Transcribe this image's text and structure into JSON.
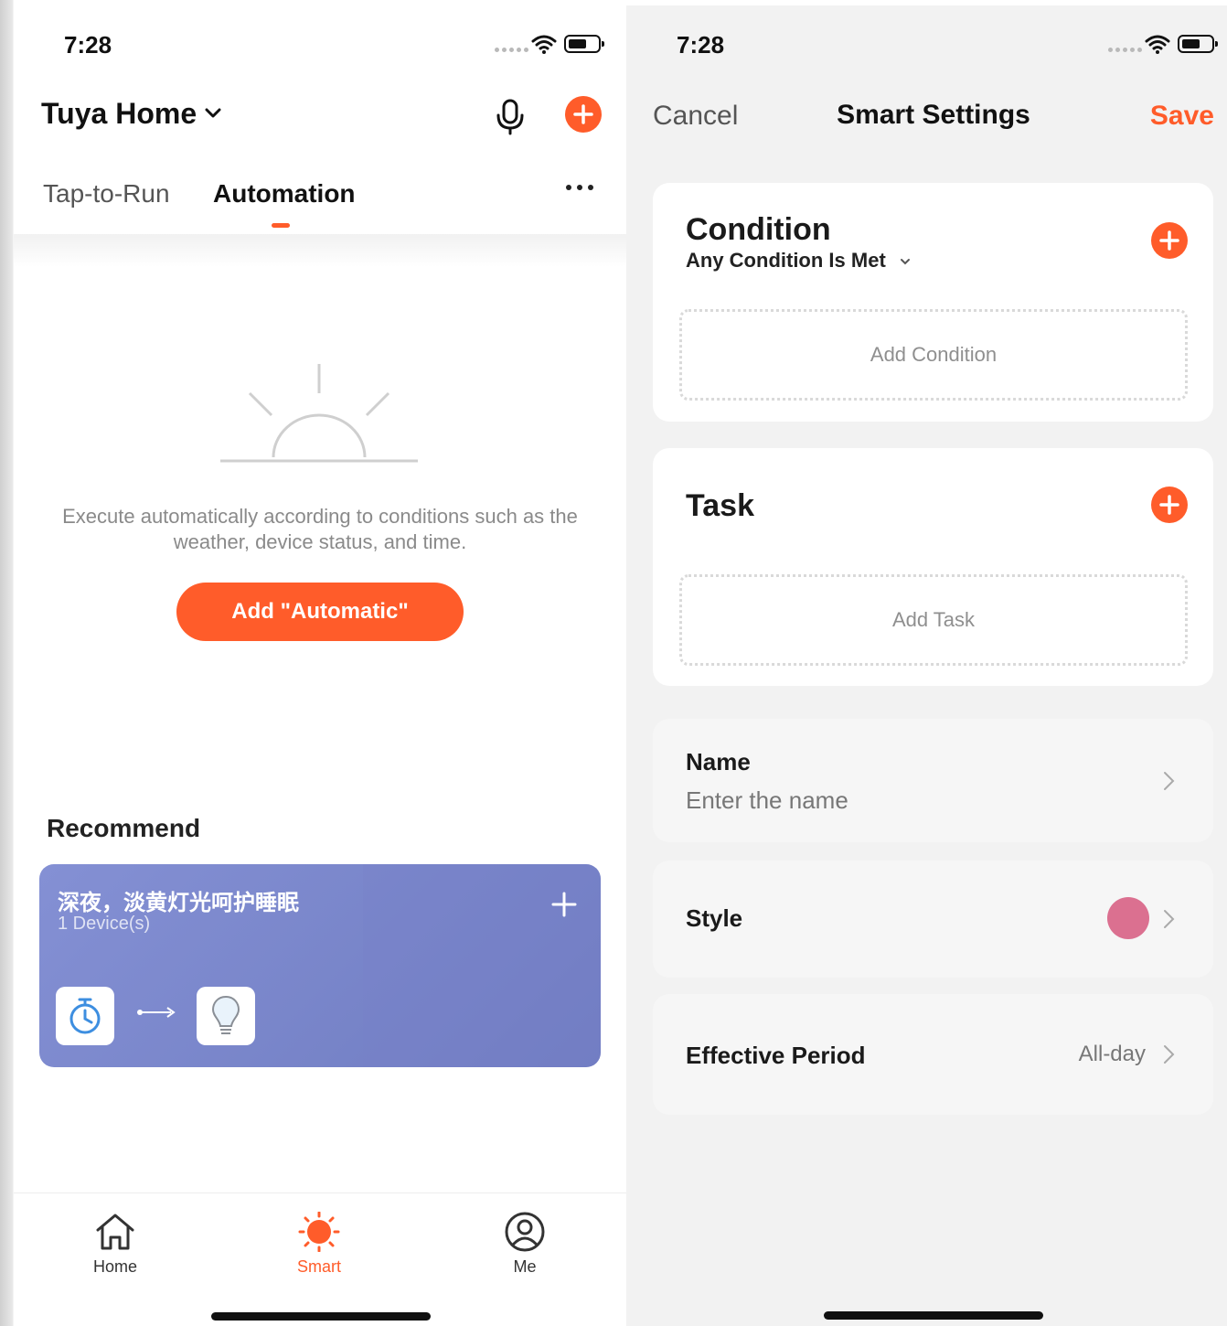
{
  "left": {
    "status": {
      "time": "7:28"
    },
    "header": {
      "home_name": "Tuya Home"
    },
    "tabs": [
      {
        "label": "Tap-to-Run",
        "active": false
      },
      {
        "label": "Automation",
        "active": true
      }
    ],
    "empty_state": {
      "description": "Execute automatically according to conditions such as the weather, device status, and time.",
      "button_label": "Add \"Automatic\""
    },
    "recommend": {
      "heading": "Recommend",
      "card": {
        "title": "深夜，淡黄灯光呵护睡眠",
        "subtitle": "1 Device(s)",
        "condition_icon": "timer-icon",
        "task_icon": "bulb-icon"
      }
    },
    "tabbar": [
      {
        "label": "Home",
        "icon": "home-icon",
        "active": false
      },
      {
        "label": "Smart",
        "icon": "sun-icon",
        "active": true
      },
      {
        "label": "Me",
        "icon": "user-icon",
        "active": false
      }
    ]
  },
  "right": {
    "status": {
      "time": "7:28"
    },
    "nav": {
      "cancel": "Cancel",
      "title": "Smart Settings",
      "save": "Save"
    },
    "condition": {
      "heading": "Condition",
      "mode": "Any Condition Is Met",
      "placeholder": "Add Condition"
    },
    "task": {
      "heading": "Task",
      "placeholder": "Add Task"
    },
    "name_row": {
      "label": "Name",
      "placeholder": "Enter the name"
    },
    "style_row": {
      "label": "Style",
      "color": "#db7090"
    },
    "period_row": {
      "label": "Effective Period",
      "value": "All-day"
    }
  },
  "colors": {
    "accent": "#ff5c2a",
    "card": "#7b86c8"
  }
}
